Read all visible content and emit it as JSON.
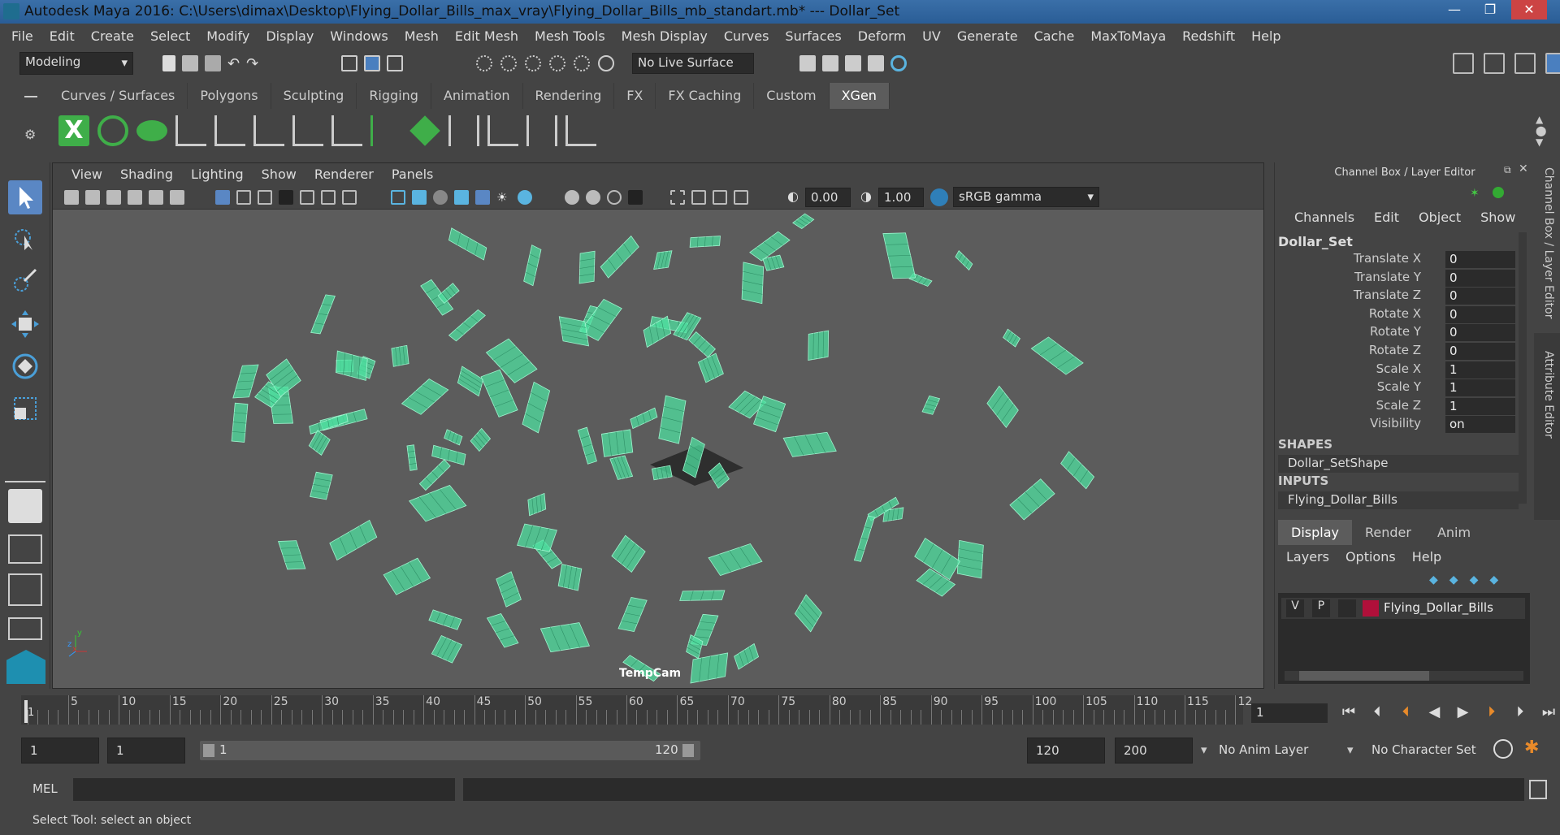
{
  "window": {
    "title": "Autodesk Maya 2016: C:\\Users\\dimax\\Desktop\\Flying_Dollar_Bills_max_vray\\Flying_Dollar_Bills_mb_standart.mb*   ---   Dollar_Set",
    "controls": [
      "—",
      "❐",
      "✕"
    ]
  },
  "menubar": [
    "File",
    "Edit",
    "Create",
    "Select",
    "Modify",
    "Display",
    "Windows",
    "Mesh",
    "Edit Mesh",
    "Mesh Tools",
    "Mesh Display",
    "Curves",
    "Surfaces",
    "Deform",
    "UV",
    "Generate",
    "Cache",
    "MaxToMaya",
    "Redshift",
    "Help"
  ],
  "statusline": {
    "mode": "Modeling",
    "live_surface": "No Live Surface"
  },
  "shelf": {
    "tabs": [
      "Curves / Surfaces",
      "Polygons",
      "Sculpting",
      "Rigging",
      "Animation",
      "Rendering",
      "FX",
      "FX Caching",
      "Custom",
      "XGen"
    ],
    "active_tab": "XGen"
  },
  "viewport": {
    "menus": [
      "View",
      "Shading",
      "Lighting",
      "Show",
      "Renderer",
      "Panels"
    ],
    "exposure": "0.00",
    "gamma": "1.00",
    "color_space": "sRGB gamma",
    "camera": "TempCam",
    "axis_labels": {
      "x": "x",
      "y": "y",
      "z": "z"
    }
  },
  "channel_box": {
    "title": "Channel Box / Layer Editor",
    "menus": [
      "Channels",
      "Edit",
      "Object",
      "Show"
    ],
    "object": "Dollar_Set",
    "attributes": [
      {
        "label": "Translate X",
        "value": "0"
      },
      {
        "label": "Translate Y",
        "value": "0"
      },
      {
        "label": "Translate Z",
        "value": "0"
      },
      {
        "label": "Rotate X",
        "value": "0"
      },
      {
        "label": "Rotate Y",
        "value": "0"
      },
      {
        "label": "Rotate Z",
        "value": "0"
      },
      {
        "label": "Scale X",
        "value": "1"
      },
      {
        "label": "Scale Y",
        "value": "1"
      },
      {
        "label": "Scale Z",
        "value": "1"
      },
      {
        "label": "Visibility",
        "value": "on"
      }
    ],
    "shapes_header": "SHAPES",
    "shape": "Dollar_SetShape",
    "inputs_header": "INPUTS",
    "input": "Flying_Dollar_Bills"
  },
  "layer_editor": {
    "tabs": [
      "Display",
      "Render",
      "Anim"
    ],
    "active_tab": "Display",
    "menus": [
      "Layers",
      "Options",
      "Help"
    ],
    "layer": {
      "v": "V",
      "p": "P",
      "name": "Flying_Dollar_Bills",
      "color": "#b0103a"
    }
  },
  "side_tabs": [
    "Channel Box / Layer Editor",
    "Attribute Editor"
  ],
  "timeline": {
    "ticks": [
      "5",
      "10",
      "15",
      "20",
      "25",
      "30",
      "35",
      "40",
      "45",
      "50",
      "55",
      "60",
      "65",
      "70",
      "75",
      "80",
      "85",
      "90",
      "95",
      "100",
      "105",
      "110",
      "115",
      "12"
    ],
    "start_marker": "1",
    "current_frame": "1"
  },
  "range": {
    "start": "1",
    "playback_start": "1",
    "slider_start": "1",
    "slider_end": "120",
    "playback_end": "120",
    "end": "200",
    "anim_layer": "No Anim Layer",
    "character_set": "No Character Set"
  },
  "command_line": {
    "label": "MEL"
  },
  "status": {
    "help_text": "Select Tool: select an object"
  },
  "colors": {
    "wireframe": "#4fe0a0",
    "viewport_bg": "#5c5c5c",
    "panel_bg": "#444444",
    "field_bg": "#2b2b2b"
  }
}
